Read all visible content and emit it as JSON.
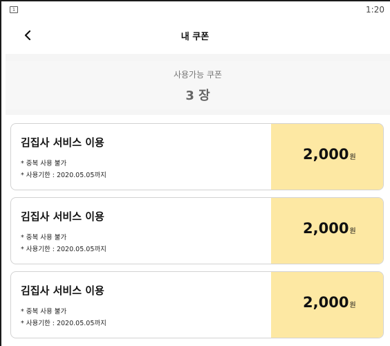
{
  "status_bar": {
    "notification_badge": "1",
    "time": "1:20"
  },
  "header": {
    "title": "내 쿠폰",
    "back_icon": "chevron-left-icon"
  },
  "summary": {
    "label": "사용가능 쿠폰",
    "count": "3 장"
  },
  "colors": {
    "coupon_amount_bg": "#fde8a3",
    "summary_bg": "#f5f5f5"
  },
  "coupons": [
    {
      "title": "김집사 서비스 이용",
      "note1": "* 중복 사용 불가",
      "note2": "* 사용기한 : 2020.05.05까지",
      "amount": "2,000",
      "unit": "원"
    },
    {
      "title": "김집사 서비스 이용",
      "note1": "* 중복 사용 불가",
      "note2": "* 사용기한 : 2020.05.05까지",
      "amount": "2,000",
      "unit": "원"
    },
    {
      "title": "김집사 서비스 이용",
      "note1": "* 중복 사용 불가",
      "note2": "* 사용기한 : 2020.05.05까지",
      "amount": "2,000",
      "unit": "원"
    }
  ]
}
